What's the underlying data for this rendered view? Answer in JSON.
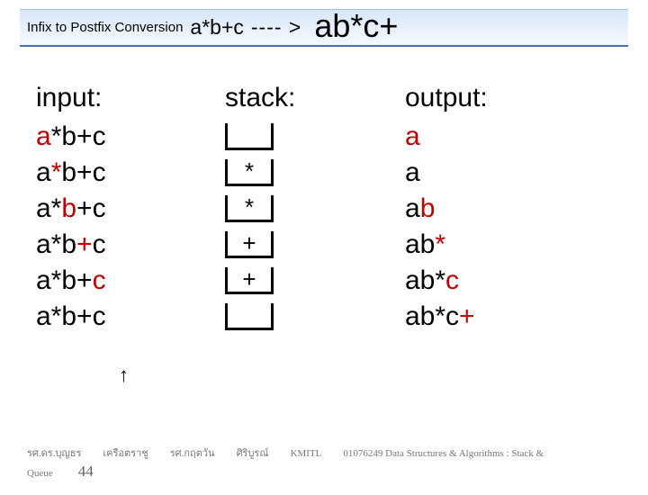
{
  "title": {
    "label": "Infix to Postfix Conversion",
    "expr": "a*b+c",
    "arrow": "---- >",
    "result": "ab*c+"
  },
  "headings": {
    "input": "input:",
    "stack": "stack:",
    "output": "output:"
  },
  "rows": [
    {
      "pre": "",
      "hl": "a",
      "post": "*b+c",
      "stack": "",
      "out_pre": "",
      "out_hl": "a",
      "out_post": ""
    },
    {
      "pre": "a",
      "hl": "*",
      "post": "b+c",
      "stack": "*",
      "out_pre": "a",
      "out_hl": "",
      "out_post": ""
    },
    {
      "pre": "a*",
      "hl": "b",
      "post": "+c",
      "stack": "*",
      "out_pre": "a",
      "out_hl": "b",
      "out_post": ""
    },
    {
      "pre": "a*b",
      "hl": "+",
      "post": "c",
      "stack": "+",
      "out_pre": "ab",
      "out_hl": "*",
      "out_post": ""
    },
    {
      "pre": "a*b+",
      "hl": "c",
      "post": "",
      "stack": "+",
      "out_pre": "ab*",
      "out_hl": "c",
      "out_post": ""
    },
    {
      "pre": "a*b+c",
      "hl": "",
      "post": "",
      "stack": "",
      "out_pre": "ab*c",
      "out_hl": "+",
      "out_post": ""
    }
  ],
  "cursor": "↑",
  "footer": {
    "author1": "รศ.ดร.บุญธร",
    "author2": "เครือตราชู",
    "author3": "รศ.กฤตวัน",
    "author4": "ศิริบูรณ์",
    "inst": "KMITL",
    "course": "01076249 Data Structures & Algorithms : Stack &",
    "queue": "Queue",
    "page": "44"
  }
}
